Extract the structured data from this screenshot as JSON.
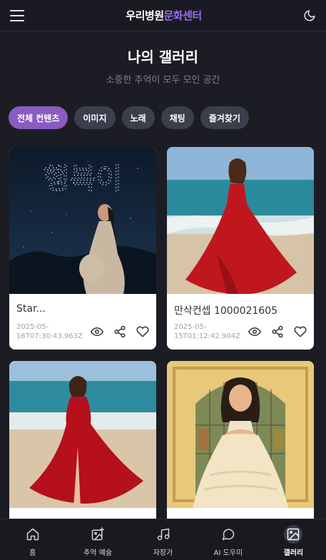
{
  "header": {
    "brand_part1": "우리병원",
    "brand_part2": "문화센터",
    "brand_color": "#9a6cf0"
  },
  "page": {
    "title": "나의 갤러리",
    "subtitle": "소중한 추억이 모두 모인 공간"
  },
  "tabs": [
    {
      "label": "전체 컨텐츠",
      "active": true
    },
    {
      "label": "이미지",
      "active": false
    },
    {
      "label": "노래",
      "active": false
    },
    {
      "label": "채팅",
      "active": false
    },
    {
      "label": "즐겨찾기",
      "active": false
    }
  ],
  "gallery": [
    {
      "caption": "Star...",
      "date": "2025-05-16T07:30:43.963Z",
      "image": "night sky with sparkle text 행복이, pregnant woman looking up"
    },
    {
      "caption": "만삭컨셉 1000021605",
      "date": "2025-05-15T01:12:42.904Z",
      "image": "woman in red dress on beach"
    },
    {
      "caption": "",
      "date": "",
      "image": "woman in red dress walking on beach"
    },
    {
      "caption": "",
      "date": "",
      "image": "illustrated girl in cream gown before stained glass"
    }
  ],
  "image_text": "행복이",
  "bottom_nav": [
    {
      "label": "홈",
      "icon": "home-icon",
      "active": false
    },
    {
      "label": "추억 예술",
      "icon": "image-plus-icon",
      "active": false
    },
    {
      "label": "자장가",
      "icon": "music-icon",
      "active": false
    },
    {
      "label": "AI 도우미",
      "icon": "chat-bubble-icon",
      "active": false
    },
    {
      "label": "갤러리",
      "icon": "gallery-icon",
      "active": true
    }
  ],
  "colors": {
    "background": "#1c1d24",
    "tab_active": "#8a5bc0",
    "tab_inactive": "#3a3f4c"
  }
}
